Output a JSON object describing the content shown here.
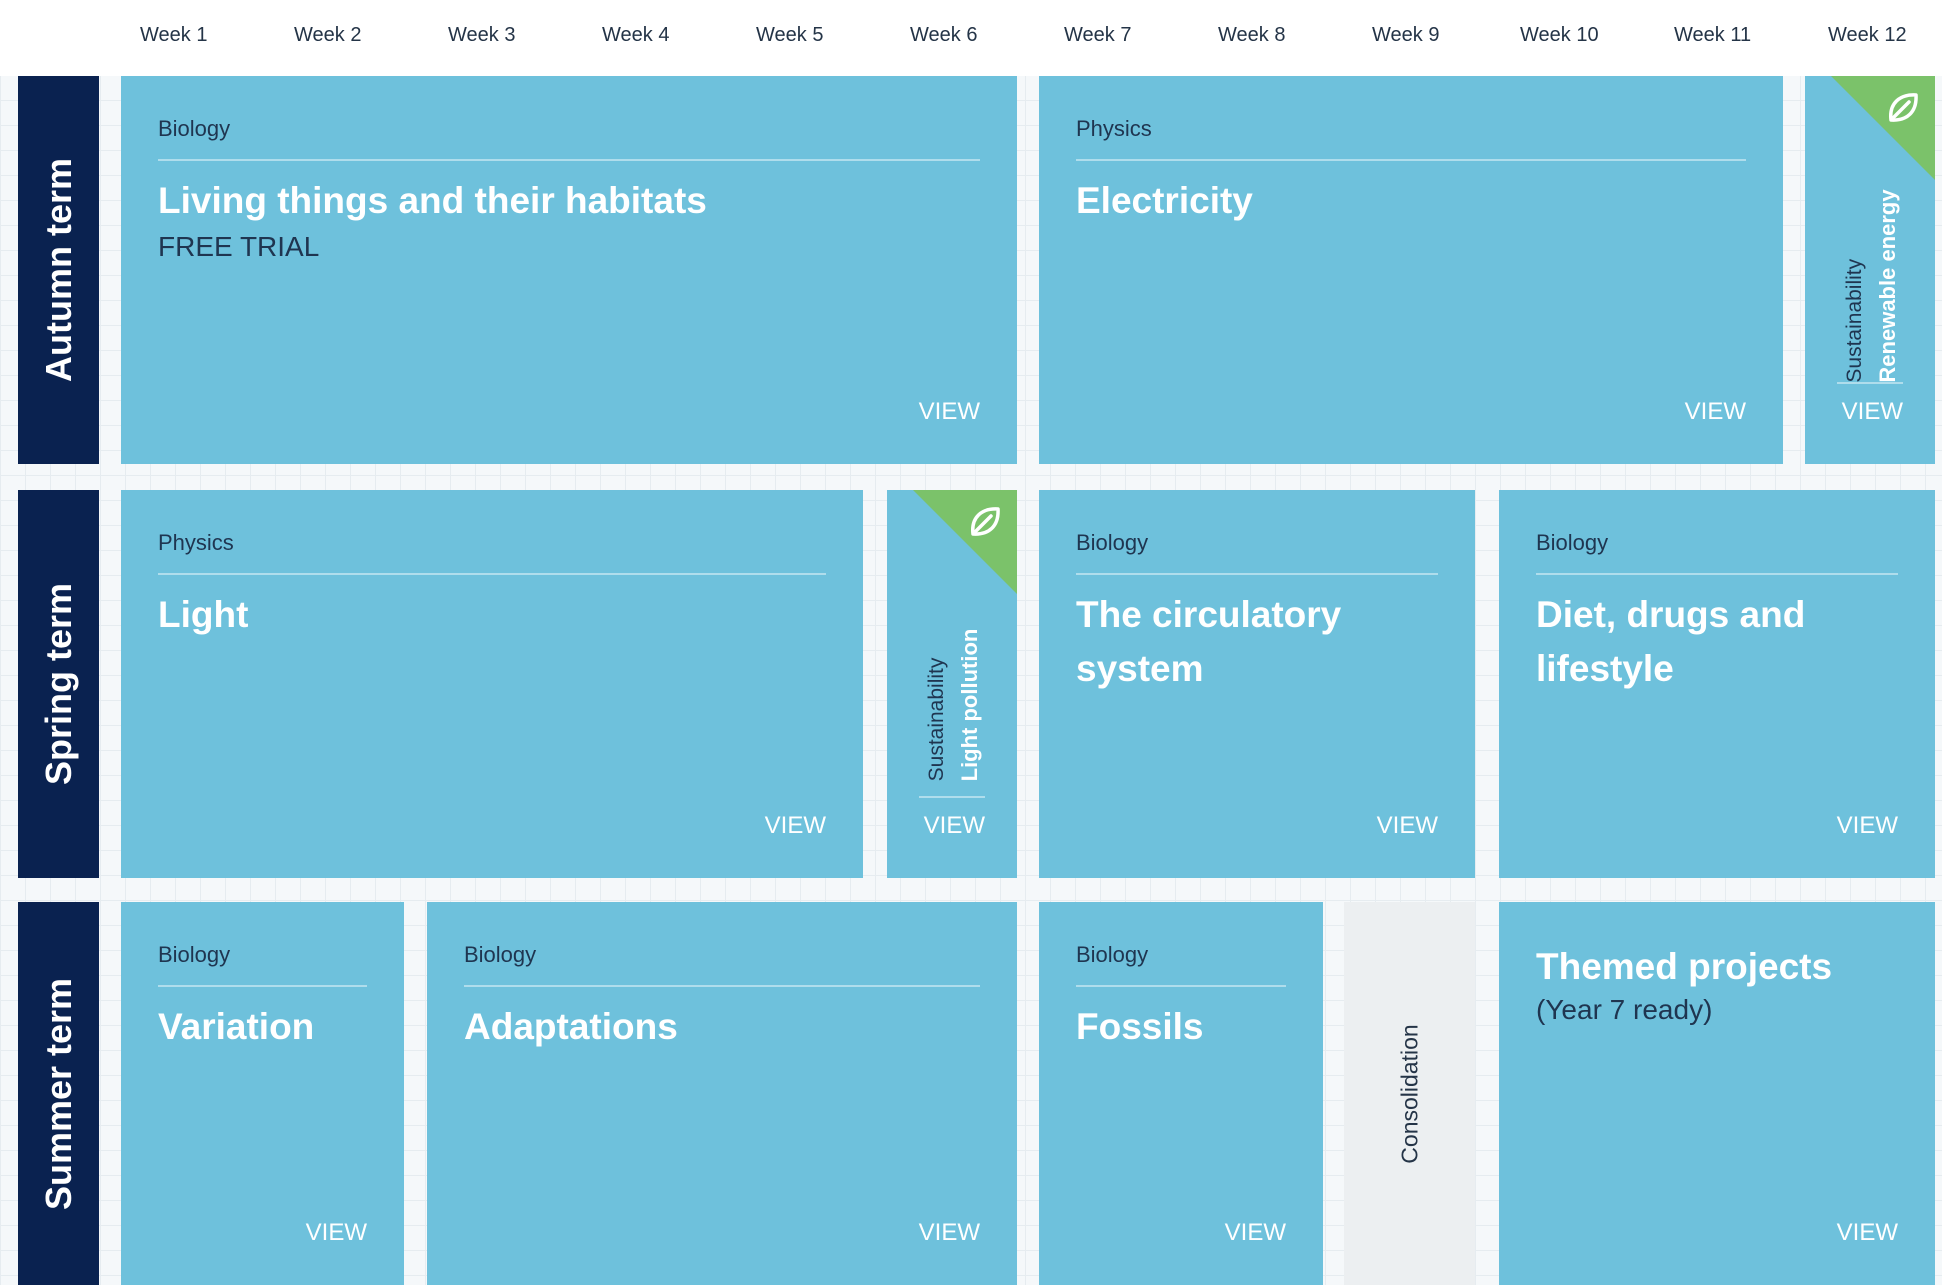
{
  "weeks": [
    "Week 1",
    "Week 2",
    "Week 3",
    "Week 4",
    "Week 5",
    "Week 6",
    "Week 7",
    "Week 8",
    "Week 9",
    "Week 10",
    "Week 11",
    "Week 12"
  ],
  "terms": {
    "autumn": "Autumn term",
    "spring": "Spring term",
    "summer": "Summer term"
  },
  "units": {
    "living_things": {
      "subject": "Biology",
      "title": "Living things and their habitats",
      "badge": "FREE TRIAL",
      "view": "VIEW"
    },
    "electricity": {
      "subject": "Physics",
      "title": "Electricity",
      "view": "VIEW"
    },
    "renewable_energy": {
      "category": "Sustainability",
      "title": "Renewable energy",
      "view": "VIEW",
      "icon": "leaf-icon"
    },
    "light": {
      "subject": "Physics",
      "title": "Light",
      "view": "VIEW"
    },
    "light_pollution": {
      "category": "Sustainability",
      "title": "Light pollution",
      "view": "VIEW",
      "icon": "leaf-icon"
    },
    "circulatory": {
      "subject": "Biology",
      "title": "The circulatory system",
      "view": "VIEW"
    },
    "diet": {
      "subject": "Biology",
      "title": "Diet, drugs and lifestyle",
      "view": "VIEW"
    },
    "variation": {
      "subject": "Biology",
      "title": "Variation",
      "view": "VIEW"
    },
    "adaptations": {
      "subject": "Biology",
      "title": "Adaptations",
      "view": "VIEW"
    },
    "fossils": {
      "subject": "Biology",
      "title": "Fossils",
      "view": "VIEW"
    },
    "consolidation": {
      "label": "Consolidation"
    },
    "themed": {
      "title": "Themed projects",
      "note": "(Year 7 ready)",
      "view": "VIEW"
    }
  },
  "colors": {
    "card": "#6ec1dc",
    "term_bar": "#0a2250",
    "sustainability_accent": "#7bc26a",
    "consolidation_bg": "#eceff1"
  }
}
